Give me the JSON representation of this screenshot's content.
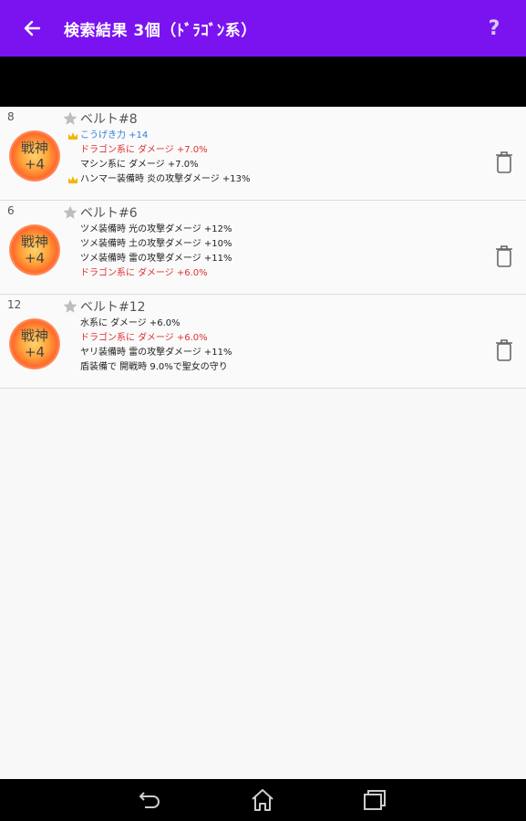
{
  "app_bar": {
    "title": "検索結果 3個（ﾄﾞﾗｺﾞﾝ系）",
    "help_label": "?",
    "color": "#7a13f0"
  },
  "results": [
    {
      "number": "8",
      "badge_line1": "戦神",
      "badge_line2": "+4",
      "name": "ベルト#8",
      "effects": [
        {
          "text": "こうげき力 +14",
          "color": "#2f7fd8",
          "crown": true
        },
        {
          "text": "ドラゴン系に ダメージ +7.0%",
          "color": "#e03030",
          "crown": false
        },
        {
          "text": "マシン系に ダメージ +7.0%",
          "color": "#222222",
          "crown": false
        },
        {
          "text": "ハンマー装備時 炎の攻撃ダメージ +13%",
          "color": "#222222",
          "crown": true
        }
      ]
    },
    {
      "number": "6",
      "badge_line1": "戦神",
      "badge_line2": "+4",
      "name": "ベルト#6",
      "effects": [
        {
          "text": "ツメ装備時 光の攻撃ダメージ +12%",
          "color": "#222222",
          "crown": false
        },
        {
          "text": "ツメ装備時 土の攻撃ダメージ +10%",
          "color": "#222222",
          "crown": false
        },
        {
          "text": "ツメ装備時 雷の攻撃ダメージ +11%",
          "color": "#222222",
          "crown": false
        },
        {
          "text": "ドラゴン系に ダメージ +6.0%",
          "color": "#e03030",
          "crown": false
        }
      ]
    },
    {
      "number": "12",
      "badge_line1": "戦神",
      "badge_line2": "+4",
      "name": "ベルト#12",
      "effects": [
        {
          "text": "水系に ダメージ +6.0%",
          "color": "#222222",
          "crown": false
        },
        {
          "text": "ドラゴン系に ダメージ +6.0%",
          "color": "#e03030",
          "crown": false
        },
        {
          "text": "ヤリ装備時 雷の攻撃ダメージ +11%",
          "color": "#222222",
          "crown": false
        },
        {
          "text": "盾装備で 開戦時 9.0%で聖女の守り",
          "color": "#222222",
          "crown": false
        }
      ]
    }
  ],
  "icons": {
    "back": "back-arrow-icon",
    "favorite": "star-icon",
    "delete": "trash-icon",
    "nav_back": "nav-back-icon",
    "nav_home": "nav-home-icon",
    "nav_recents": "nav-recents-icon"
  }
}
